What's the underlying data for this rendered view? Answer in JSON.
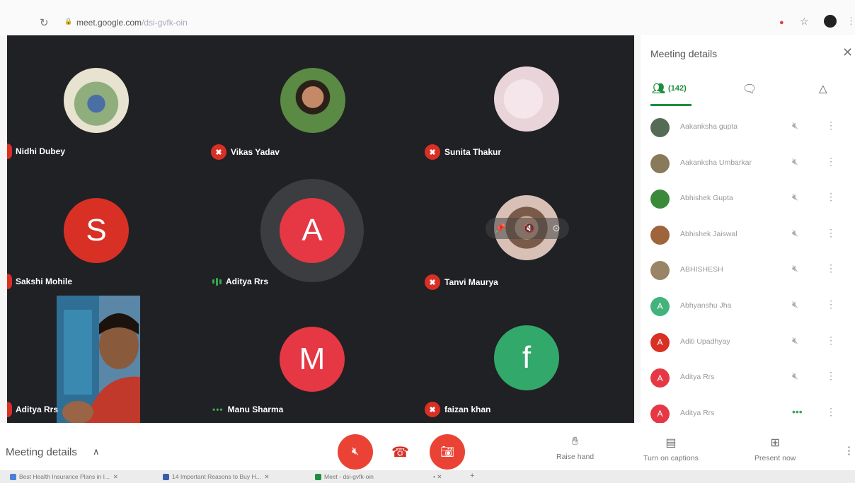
{
  "browser": {
    "url_host": "meet.google.com",
    "url_path": "/dsi-gvfk-oin"
  },
  "participants_grid": [
    {
      "name": "Nidhi Dubey",
      "kind": "photo",
      "status": "muted"
    },
    {
      "name": "Vikas Yadav",
      "kind": "photo",
      "status": "muted"
    },
    {
      "name": "Sunita Thakur",
      "kind": "photo",
      "status": "muted"
    },
    {
      "name": "Sakshi Mohile",
      "kind": "letter",
      "letter": "S",
      "color": "#d93025",
      "status": "muted"
    },
    {
      "name": "Aditya Rrs",
      "kind": "letter",
      "letter": "A",
      "color": "#e53844",
      "status": "speaking"
    },
    {
      "name": "Tanvi Maurya",
      "kind": "photo",
      "status": "muted"
    },
    {
      "name": "Aditya Rrs",
      "kind": "video",
      "status": "muted"
    },
    {
      "name": "Manu Sharma",
      "kind": "letter",
      "letter": "M",
      "color": "#e53844",
      "status": "active"
    },
    {
      "name": "faizan khan",
      "kind": "letter",
      "letter": "f",
      "color": "#33a86b",
      "status": "muted"
    }
  ],
  "panel": {
    "title": "Meeting details",
    "people_count": "(142)",
    "participants": [
      {
        "name": "Aakanksha gupta",
        "avatar_color": "#556b55",
        "letter": ""
      },
      {
        "name": "Aakanksha Umbarkar",
        "avatar_color": "#8a7a5c",
        "letter": ""
      },
      {
        "name": "Abhishek Gupta",
        "avatar_color": "#3b8a3b",
        "letter": ""
      },
      {
        "name": "Abhishek Jaiswal",
        "avatar_color": "#a0643c",
        "letter": ""
      },
      {
        "name": "ABHISHESH",
        "avatar_color": "#9a8466",
        "letter": ""
      },
      {
        "name": "Abhyanshu Jha",
        "avatar_color": "#42b37a",
        "letter": "A"
      },
      {
        "name": "Aditi Upadhyay",
        "avatar_color": "#d93025",
        "letter": "A"
      },
      {
        "name": "Aditya Rrs",
        "avatar_color": "#e53844",
        "letter": "A"
      },
      {
        "name": "Aditya Rrs",
        "avatar_color": "#e53844",
        "letter": "A"
      }
    ]
  },
  "bottombar": {
    "meeting_details": "Meeting details",
    "raise_hand": "Raise hand",
    "captions": "Turn on captions",
    "present": "Present now"
  },
  "tabs": [
    {
      "label": "Best Health Insurance Plans in I...",
      "color": "#4a7fd6"
    },
    {
      "label": "14 Important Reasons to Buy H...",
      "color": "#3a5da8"
    },
    {
      "label": "Meet - dsi-gvfk-oin",
      "color": "#1e8e3e"
    }
  ]
}
